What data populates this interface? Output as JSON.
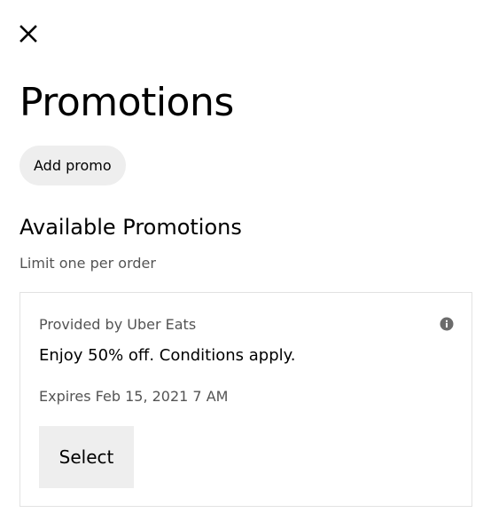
{
  "header": {
    "close_icon": "close-icon",
    "title": "Promotions"
  },
  "actions": {
    "add_promo_label": "Add promo"
  },
  "available": {
    "title": "Available Promotions",
    "subtitle": "Limit one per order"
  },
  "promotions": [
    {
      "provider": "Provided by Uber Eats",
      "description": "Enjoy 50% off. Conditions apply.",
      "expires": "Expires Feb 15, 2021 7 AM",
      "select_label": "Select",
      "info_icon": "info-icon"
    }
  ],
  "colors": {
    "button_bg": "#eeeeee",
    "secondary_text": "#545454",
    "card_border": "#e2e2e2"
  }
}
